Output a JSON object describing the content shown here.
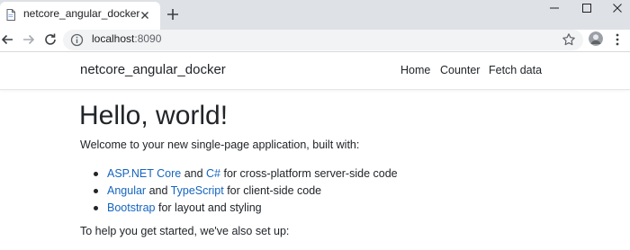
{
  "browser": {
    "tab_title": "netcore_angular_docker",
    "url_host": "localhost",
    "url_port": ":8090"
  },
  "navbar": {
    "brand": "netcore_angular_docker",
    "links": [
      "Home",
      "Counter",
      "Fetch data"
    ]
  },
  "content": {
    "heading": "Hello, world!",
    "intro": "Welcome to your new single-page application, built with:",
    "items": [
      {
        "link1": "ASP.NET Core",
        "mid": " and ",
        "link2": "C#",
        "rest": " for cross-platform server-side code"
      },
      {
        "link1": "Angular",
        "mid": " and ",
        "link2": "TypeScript",
        "rest": " for client-side code"
      },
      {
        "link1": "Bootstrap",
        "rest": " for layout and styling"
      }
    ],
    "outro": "To help you get started, we've also set up:"
  },
  "colors": {
    "tabstrip": "#dee1e6",
    "omnibox": "#f1f3f4",
    "link": "#1565c0",
    "text": "#212529"
  },
  "icons": [
    "document-icon",
    "close-icon",
    "plus-icon",
    "minimize-icon",
    "maximize-icon",
    "window-close-icon",
    "back-icon",
    "forward-icon",
    "reload-icon",
    "info-icon",
    "star-icon",
    "avatar",
    "kebab-menu-icon"
  ]
}
